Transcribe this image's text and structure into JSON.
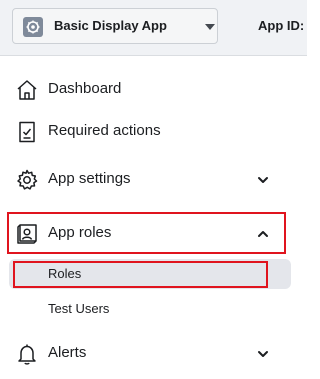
{
  "topbar": {
    "app_name": "Basic Display App",
    "app_icon": "gear-icon",
    "app_id_label": "App ID:"
  },
  "nav": {
    "dashboard": {
      "label": "Dashboard",
      "icon": "house-icon"
    },
    "required_actions": {
      "label": "Required actions",
      "icon": "checklist-icon"
    },
    "app_settings": {
      "label": "App settings",
      "icon": "gear-icon",
      "expanded": false
    },
    "app_roles": {
      "label": "App roles",
      "icon": "id-badge-icon",
      "expanded": true,
      "children": [
        {
          "label": "Roles",
          "selected": true
        },
        {
          "label": "Test Users",
          "selected": false
        }
      ]
    },
    "alerts": {
      "label": "Alerts",
      "icon": "bell-icon",
      "expanded": false
    }
  },
  "colors": {
    "highlight": "#e0141e",
    "selected_bg": "#e4e6eb",
    "topbar_bg": "#f0f2f5"
  }
}
